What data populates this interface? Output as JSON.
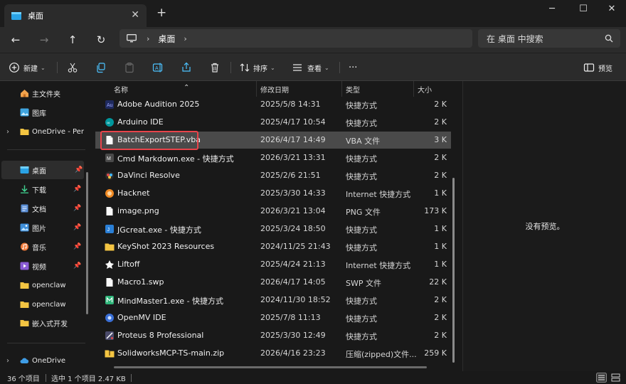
{
  "window": {
    "tab_title": "桌面",
    "tab_close": "✕",
    "tab_add": "+",
    "minimize": "─",
    "maximize": "☐",
    "close": "✕"
  },
  "nav": {
    "back": "←",
    "forward": "→",
    "up": "↑",
    "refresh": "↻",
    "breadcrumb_sep": "›",
    "crumb": "桌面",
    "search_placeholder": "在 桌面 中搜索"
  },
  "toolbar": {
    "new_label": "新建",
    "sort_label": "排序",
    "view_label": "查看",
    "more_label": "···",
    "preview_label": "预览"
  },
  "sidebar": {
    "items": [
      {
        "label": "主文件夹",
        "icon": "home-icon"
      },
      {
        "label": "图库",
        "icon": "gallery-icon"
      },
      {
        "label": "OneDrive - Per",
        "icon": "folder-icon"
      },
      {
        "label": "桌面",
        "icon": "desktop-icon"
      },
      {
        "label": "下载",
        "icon": "download-icon"
      },
      {
        "label": "文档",
        "icon": "documents-icon"
      },
      {
        "label": "图片",
        "icon": "pictures-icon"
      },
      {
        "label": "音乐",
        "icon": "music-icon"
      },
      {
        "label": "视频",
        "icon": "video-icon"
      },
      {
        "label": "openclaw",
        "icon": "folder-icon"
      },
      {
        "label": "openclaw",
        "icon": "folder-icon"
      },
      {
        "label": "嵌入式开发",
        "icon": "folder-icon"
      },
      {
        "label": "OneDrive",
        "icon": "cloud-icon"
      }
    ]
  },
  "columns": {
    "name": "名称",
    "modified": "修改日期",
    "type": "类型",
    "size": "大小"
  },
  "files": [
    {
      "name": "Adobe Audition 2025",
      "date": "2025/5/8 14:31",
      "type": "快捷方式",
      "size": "2 K"
    },
    {
      "name": "Arduino IDE",
      "date": "2025/4/17 10:54",
      "type": "快捷方式",
      "size": "2 K"
    },
    {
      "name": "BatchExportSTEP.vba",
      "date": "2026/4/17 14:49",
      "type": "VBA 文件",
      "size": "3 K"
    },
    {
      "name": "Cmd Markdown.exe - 快捷方式",
      "date": "2026/3/21 13:31",
      "type": "快捷方式",
      "size": "2 K"
    },
    {
      "name": "DaVinci Resolve",
      "date": "2025/2/6 21:51",
      "type": "快捷方式",
      "size": "2 K"
    },
    {
      "name": "Hacknet",
      "date": "2025/3/30 14:33",
      "type": "Internet 快捷方式",
      "size": "1 K"
    },
    {
      "name": "image.png",
      "date": "2026/3/21 13:04",
      "type": "PNG 文件",
      "size": "173 K"
    },
    {
      "name": "JGcreat.exe - 快捷方式",
      "date": "2025/3/24 18:50",
      "type": "快捷方式",
      "size": "1 K"
    },
    {
      "name": "KeyShot 2023 Resources",
      "date": "2024/11/25 21:43",
      "type": "快捷方式",
      "size": "1 K"
    },
    {
      "name": "Liftoff",
      "date": "2025/4/24 21:13",
      "type": "Internet 快捷方式",
      "size": "1 K"
    },
    {
      "name": "Macro1.swp",
      "date": "2026/4/17 14:05",
      "type": "SWP 文件",
      "size": "22 K"
    },
    {
      "name": "MindMaster1.exe - 快捷方式",
      "date": "2024/11/30 18:52",
      "type": "快捷方式",
      "size": "2 K"
    },
    {
      "name": "OpenMV IDE",
      "date": "2025/7/8 11:13",
      "type": "快捷方式",
      "size": "2 K"
    },
    {
      "name": "Proteus 8 Professional",
      "date": "2025/3/30 12:49",
      "type": "快捷方式",
      "size": "2 K"
    },
    {
      "name": "SolidworksMCP-TS-main.zip",
      "date": "2026/4/16 23:23",
      "type": "压缩(zipped)文件...",
      "size": "259 K"
    }
  ],
  "preview": {
    "no_preview": "没有预览。"
  },
  "status": {
    "count": "36 个项目",
    "selection": "选中 1 个项目  2.47 KB"
  },
  "colors": {
    "accent": "#4cc2ff",
    "folder": "#f4c542",
    "highlight_border": "#e8434a"
  }
}
